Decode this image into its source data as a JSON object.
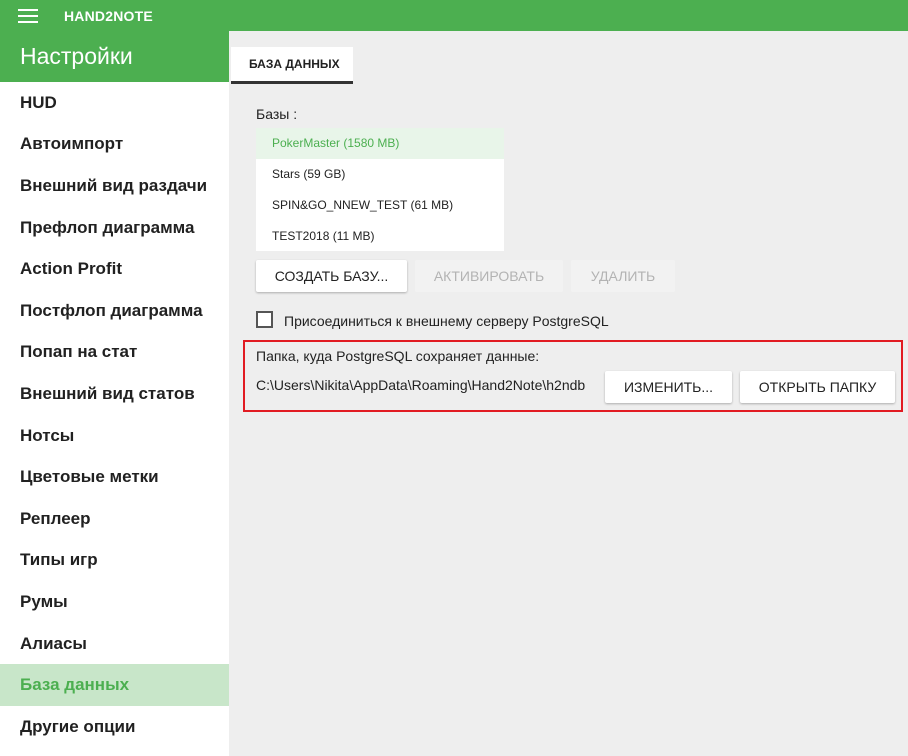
{
  "app": {
    "title": "HAND2NOTE",
    "menu_icon": "hamburger-menu-icon"
  },
  "sidebar": {
    "header": "Настройки",
    "items": [
      {
        "label": "HUD"
      },
      {
        "label": "Автоимпорт"
      },
      {
        "label": "Внешний вид раздачи"
      },
      {
        "label": "Префлоп диаграмма"
      },
      {
        "label": "Action Profit"
      },
      {
        "label": "Постфлоп диаграмма"
      },
      {
        "label": "Попап на стат"
      },
      {
        "label": "Внешний вид статов"
      },
      {
        "label": "Нотсы"
      },
      {
        "label": "Цветовые метки"
      },
      {
        "label": "Реплеер"
      },
      {
        "label": "Типы игр"
      },
      {
        "label": "Румы"
      },
      {
        "label": "Алиасы"
      },
      {
        "label": "База данных",
        "active": true
      },
      {
        "label": "Другие опции"
      }
    ]
  },
  "tab": {
    "label": "БАЗА ДАННЫХ"
  },
  "databases": {
    "label": "Базы :",
    "items": [
      {
        "name": "PokerMaster (1580 MB)",
        "selected": true
      },
      {
        "name": "Stars (59 GB)"
      },
      {
        "name": "SPIN&GO_NNEW_TEST (61 MB)"
      },
      {
        "name": "TEST2018 (11 MB)"
      }
    ],
    "buttons": {
      "create": "СОЗДАТЬ БАЗУ...",
      "activate": "АКТИВИРОВАТЬ",
      "delete": "УДАЛИТЬ"
    }
  },
  "external_server": {
    "label": "Присоединиться к внешнему серверу PostgreSQL",
    "checked": false
  },
  "data_folder": {
    "label": "Папка, куда PostgreSQL сохраняет данные:",
    "path": "C:\\Users\\Nikita\\AppData\\Roaming\\Hand2Note\\h2ndb",
    "change_button": "ИЗМЕНИТЬ...",
    "open_button": "ОТКРЫТЬ ПАПКУ"
  },
  "colors": {
    "accent": "#4caf50",
    "highlight": "#e11b22"
  }
}
